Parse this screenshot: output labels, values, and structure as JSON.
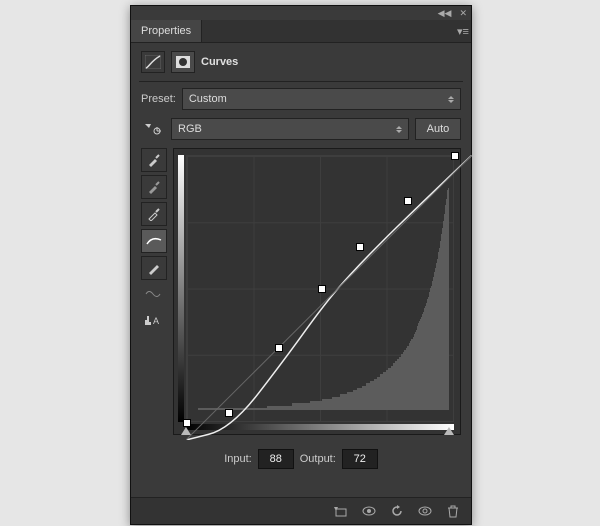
{
  "tabs": [
    "Properties"
  ],
  "title": "Curves",
  "preset": {
    "label": "Preset:",
    "value": "Custom"
  },
  "channel": {
    "value": "RGB"
  },
  "autoLabel": "Auto",
  "io": {
    "inputLabel": "Input:",
    "input": "88",
    "outputLabel": "Output:",
    "output": "72"
  },
  "chart_data": {
    "type": "line",
    "title": "Curves",
    "xlabel": "Input",
    "ylabel": "Output",
    "xlim": [
      0,
      255
    ],
    "ylim": [
      0,
      255
    ],
    "series": [
      {
        "name": "RGB",
        "points": [
          {
            "x": 0,
            "y": 0
          },
          {
            "x": 40,
            "y": 10
          },
          {
            "x": 88,
            "y": 72
          },
          {
            "x": 128,
            "y": 128
          },
          {
            "x": 165,
            "y": 168
          },
          {
            "x": 210,
            "y": 212
          },
          {
            "x": 255,
            "y": 255
          }
        ]
      }
    ],
    "histogram": [
      1,
      1,
      1,
      1,
      1,
      1,
      1,
      1,
      1,
      1,
      1,
      1,
      1,
      1,
      1,
      1,
      1,
      1,
      1,
      1,
      1,
      1,
      1,
      1,
      1,
      1,
      1,
      1,
      1,
      1,
      1,
      1,
      1,
      1,
      1,
      1,
      1,
      1,
      1,
      1,
      1,
      1,
      1,
      1,
      1,
      1,
      1,
      1,
      1,
      1,
      1,
      1,
      1,
      1,
      1,
      1,
      1,
      1,
      1,
      1,
      1,
      1,
      1,
      1,
      1,
      1,
      1,
      1,
      1,
      1,
      2,
      2,
      2,
      2,
      2,
      2,
      2,
      2,
      2,
      2,
      2,
      2,
      2,
      2,
      2,
      2,
      2,
      2,
      2,
      2,
      2,
      2,
      2,
      2,
      2,
      2,
      3,
      3,
      3,
      3,
      3,
      3,
      3,
      3,
      3,
      3,
      3,
      3,
      3,
      3,
      3,
      3,
      3,
      3,
      4,
      4,
      4,
      4,
      4,
      4,
      4,
      4,
      4,
      4,
      4,
      4,
      5,
      5,
      5,
      5,
      5,
      5,
      5,
      5,
      5,
      5,
      6,
      6,
      6,
      6,
      6,
      6,
      6,
      6,
      7,
      7,
      7,
      7,
      7,
      7,
      7,
      8,
      8,
      8,
      8,
      8,
      8,
      9,
      9,
      9,
      9,
      9,
      10,
      10,
      10,
      10,
      10,
      11,
      11,
      11,
      11,
      12,
      12,
      12,
      12,
      13,
      13,
      13,
      13,
      14,
      14,
      14,
      15,
      15,
      15,
      16,
      16,
      16,
      17,
      17,
      17,
      18,
      18,
      19,
      19,
      19,
      20,
      20,
      21,
      21,
      22,
      22,
      23,
      23,
      24,
      24,
      25,
      25,
      26,
      27,
      27,
      28,
      29,
      29,
      30,
      31,
      32,
      32,
      33,
      34,
      35,
      36,
      37,
      38,
      39,
      40,
      41,
      42,
      43,
      44,
      46,
      47,
      48,
      50,
      51,
      53,
      55,
      56,
      58,
      60,
      62,
      64,
      66,
      68,
      71,
      73,
      76,
      79,
      82,
      85,
      88,
      92,
      95,
      99,
      100
    ]
  }
}
